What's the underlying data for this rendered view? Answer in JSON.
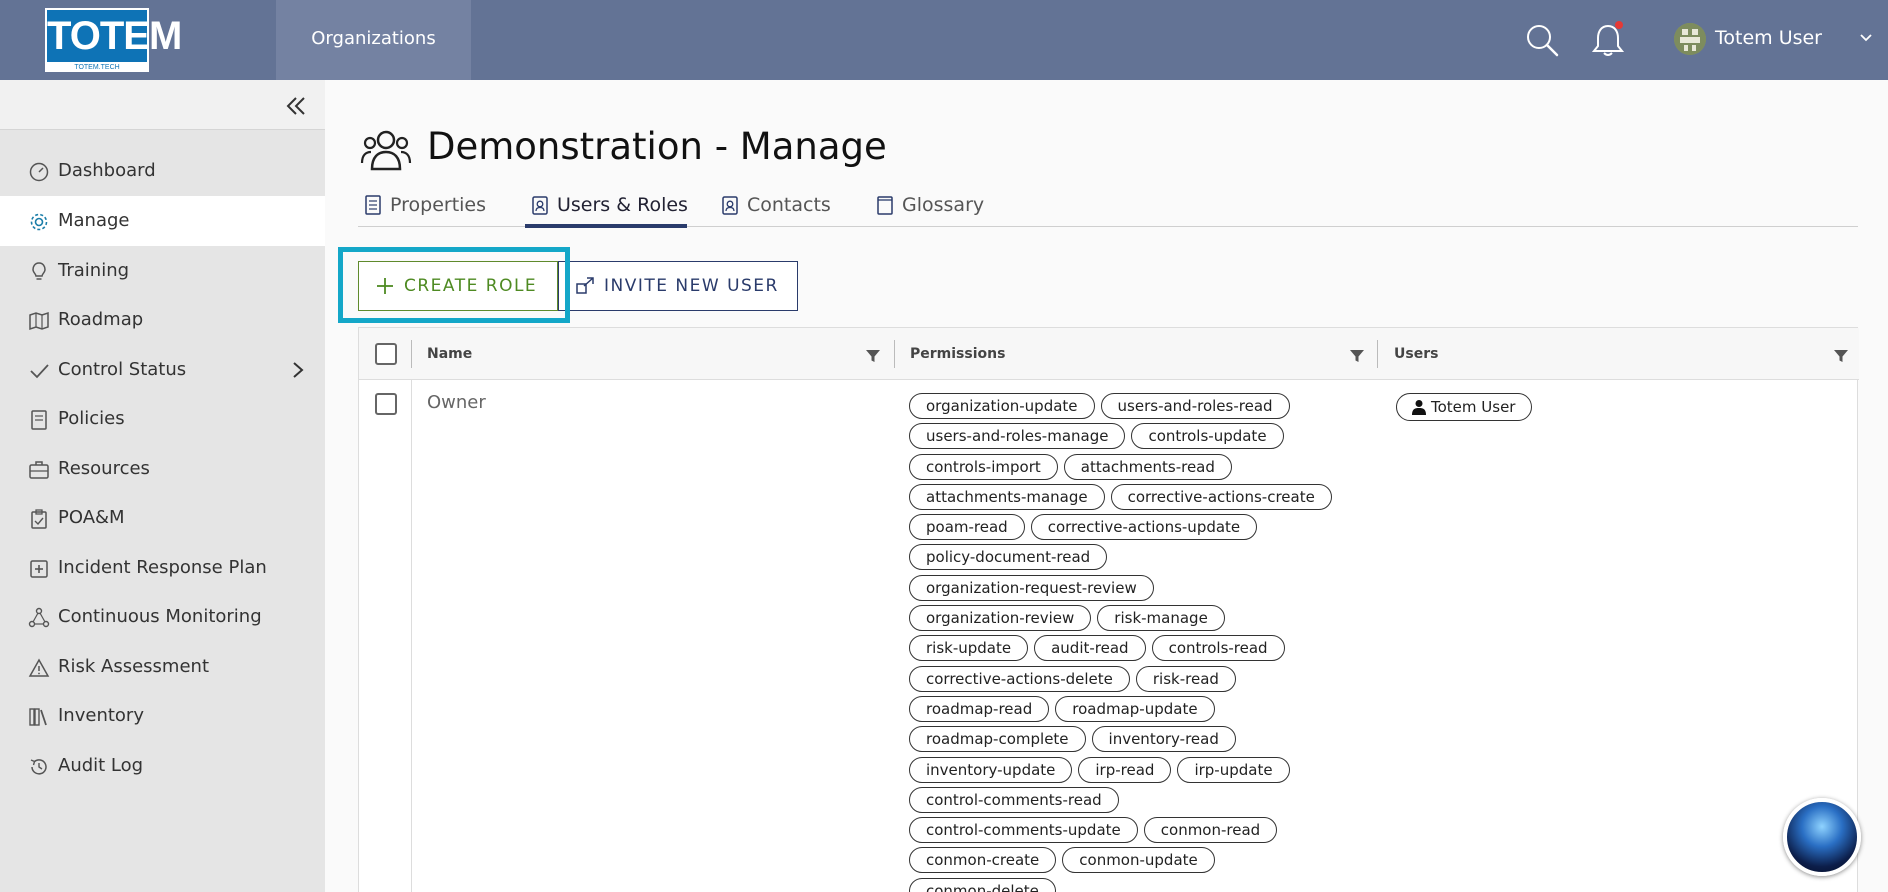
{
  "header": {
    "logo_text": "TOTEM",
    "logo_sub": "TOTEM.TECH",
    "org_tab": "Organizations",
    "user_name": "Totem User"
  },
  "sidebar": {
    "items": [
      {
        "label": "Dashboard",
        "icon": "gauge-icon"
      },
      {
        "label": "Manage",
        "icon": "gear-icon",
        "active": true
      },
      {
        "label": "Training",
        "icon": "lightbulb-icon"
      },
      {
        "label": "Roadmap",
        "icon": "map-icon"
      },
      {
        "label": "Control Status",
        "icon": "check-icon",
        "has_submenu": true
      },
      {
        "label": "Policies",
        "icon": "document-icon"
      },
      {
        "label": "Resources",
        "icon": "briefcase-icon"
      },
      {
        "label": "POA&M",
        "icon": "clipboard-icon"
      },
      {
        "label": "Incident Response Plan",
        "icon": "first-aid-icon"
      },
      {
        "label": "Continuous Monitoring",
        "icon": "network-icon"
      },
      {
        "label": "Risk Assessment",
        "icon": "warning-icon"
      },
      {
        "label": "Inventory",
        "icon": "library-icon"
      },
      {
        "label": "Audit Log",
        "icon": "history-icon"
      }
    ]
  },
  "main": {
    "title": "Demonstration - Manage",
    "tabs": [
      {
        "label": "Properties"
      },
      {
        "label": "Users & Roles",
        "active": true
      },
      {
        "label": "Contacts"
      },
      {
        "label": "Glossary"
      }
    ],
    "buttons": {
      "create_role": "CREATE ROLE",
      "invite_user": "INVITE NEW USER"
    },
    "table": {
      "columns": [
        "Name",
        "Permissions",
        "Users"
      ],
      "rows": [
        {
          "name": "Owner",
          "permissions": [
            [
              "organization-update",
              "users-and-roles-read"
            ],
            [
              "users-and-roles-manage",
              "controls-update"
            ],
            [
              "controls-import",
              "attachments-read"
            ],
            [
              "attachments-manage",
              "corrective-actions-create"
            ],
            [
              "poam-read",
              "corrective-actions-update"
            ],
            [
              "policy-document-read"
            ],
            [
              "organization-request-review"
            ],
            [
              "organization-review",
              "risk-manage"
            ],
            [
              "risk-update",
              "audit-read",
              "controls-read"
            ],
            [
              "corrective-actions-delete",
              "risk-read"
            ],
            [
              "roadmap-read",
              "roadmap-update"
            ],
            [
              "roadmap-complete",
              "inventory-read"
            ],
            [
              "inventory-update",
              "irp-read",
              "irp-update"
            ],
            [
              "control-comments-read"
            ],
            [
              "control-comments-update",
              "conmon-read"
            ],
            [
              "conmon-create",
              "conmon-update"
            ],
            [
              "conmon-delete"
            ]
          ],
          "users": [
            "Totem User"
          ]
        }
      ]
    }
  }
}
